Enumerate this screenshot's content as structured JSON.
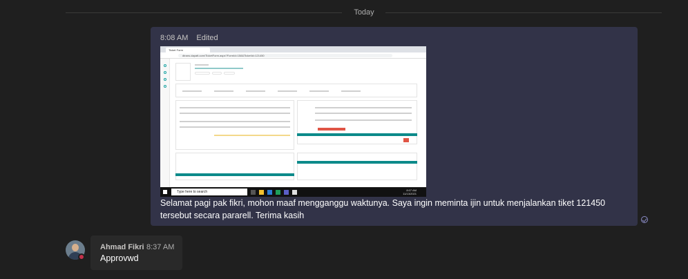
{
  "divider": {
    "label": "Today"
  },
  "sent_message": {
    "time": "8:08 AM",
    "edited_label": "Edited",
    "text": "Selamat pagi pak fikri, mohon maaf mengganggu waktunya. Saya ingin meminta ijin untuk menjalankan tiket 121450 tersebut secara pararell. Terima kasih",
    "attachment": {
      "browser_tab": "Ticket Form",
      "address": "dtrans.dapatt.com/TicketForm.aspx?FormId=158&TicketId=121450",
      "taskbar_search": "Type here to search",
      "taskbar_time": "8:07 AM",
      "taskbar_date": "11/13/2021"
    }
  },
  "received_message": {
    "sender": "Ahmad Fikri",
    "time": "8:37 AM",
    "text": "Approvwd"
  },
  "colors": {
    "background": "#1f1f1f",
    "sent_bubble": "#323348",
    "received_bubble": "#292929",
    "presence_busy": "#c4314b"
  },
  "icons": [
    "read-receipt-icon",
    "presence-busy-icon",
    "windows-logo-icon"
  ]
}
